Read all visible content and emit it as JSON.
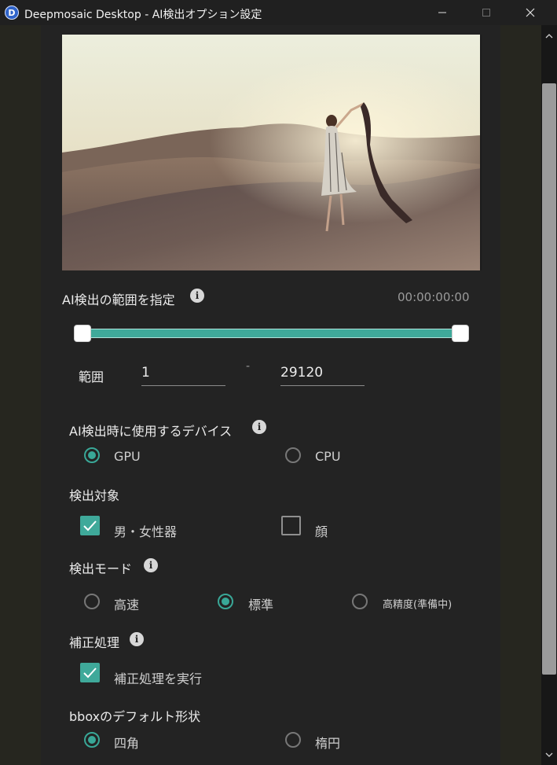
{
  "window": {
    "title": "Deepmosaic Desktop - AI検出オプション設定",
    "app_icon_letter": "D"
  },
  "range_section": {
    "title": "AI検出の範囲を指定",
    "timecode": "00:00:00:00",
    "slider_range": [
      0,
      1
    ],
    "range_label": "範囲",
    "start_value": "1",
    "separator": "-",
    "end_value": "29120"
  },
  "device_section": {
    "title": "AI検出時に使用するデバイス",
    "options": [
      {
        "label": "GPU",
        "selected": true
      },
      {
        "label": "CPU",
        "selected": false
      }
    ]
  },
  "target_section": {
    "title": "検出対象",
    "options": [
      {
        "label": "男・女性器",
        "checked": true
      },
      {
        "label": "顔",
        "checked": false
      }
    ]
  },
  "mode_section": {
    "title": "検出モード",
    "options": [
      {
        "label": "高速",
        "selected": false
      },
      {
        "label": "標準",
        "selected": true
      },
      {
        "label": "高精度(準備中)",
        "selected": false
      }
    ]
  },
  "correction_section": {
    "title": "補正処理",
    "checkbox_label": "補正処理を実行",
    "checked": true
  },
  "bbox_section": {
    "title": "bboxのデフォルト形状",
    "options": [
      {
        "label": "四角",
        "selected": true
      },
      {
        "label": "楕円",
        "selected": false
      }
    ]
  },
  "colors": {
    "accent": "#3fa99a",
    "panel": "#232323",
    "titlebar": "#202020"
  }
}
